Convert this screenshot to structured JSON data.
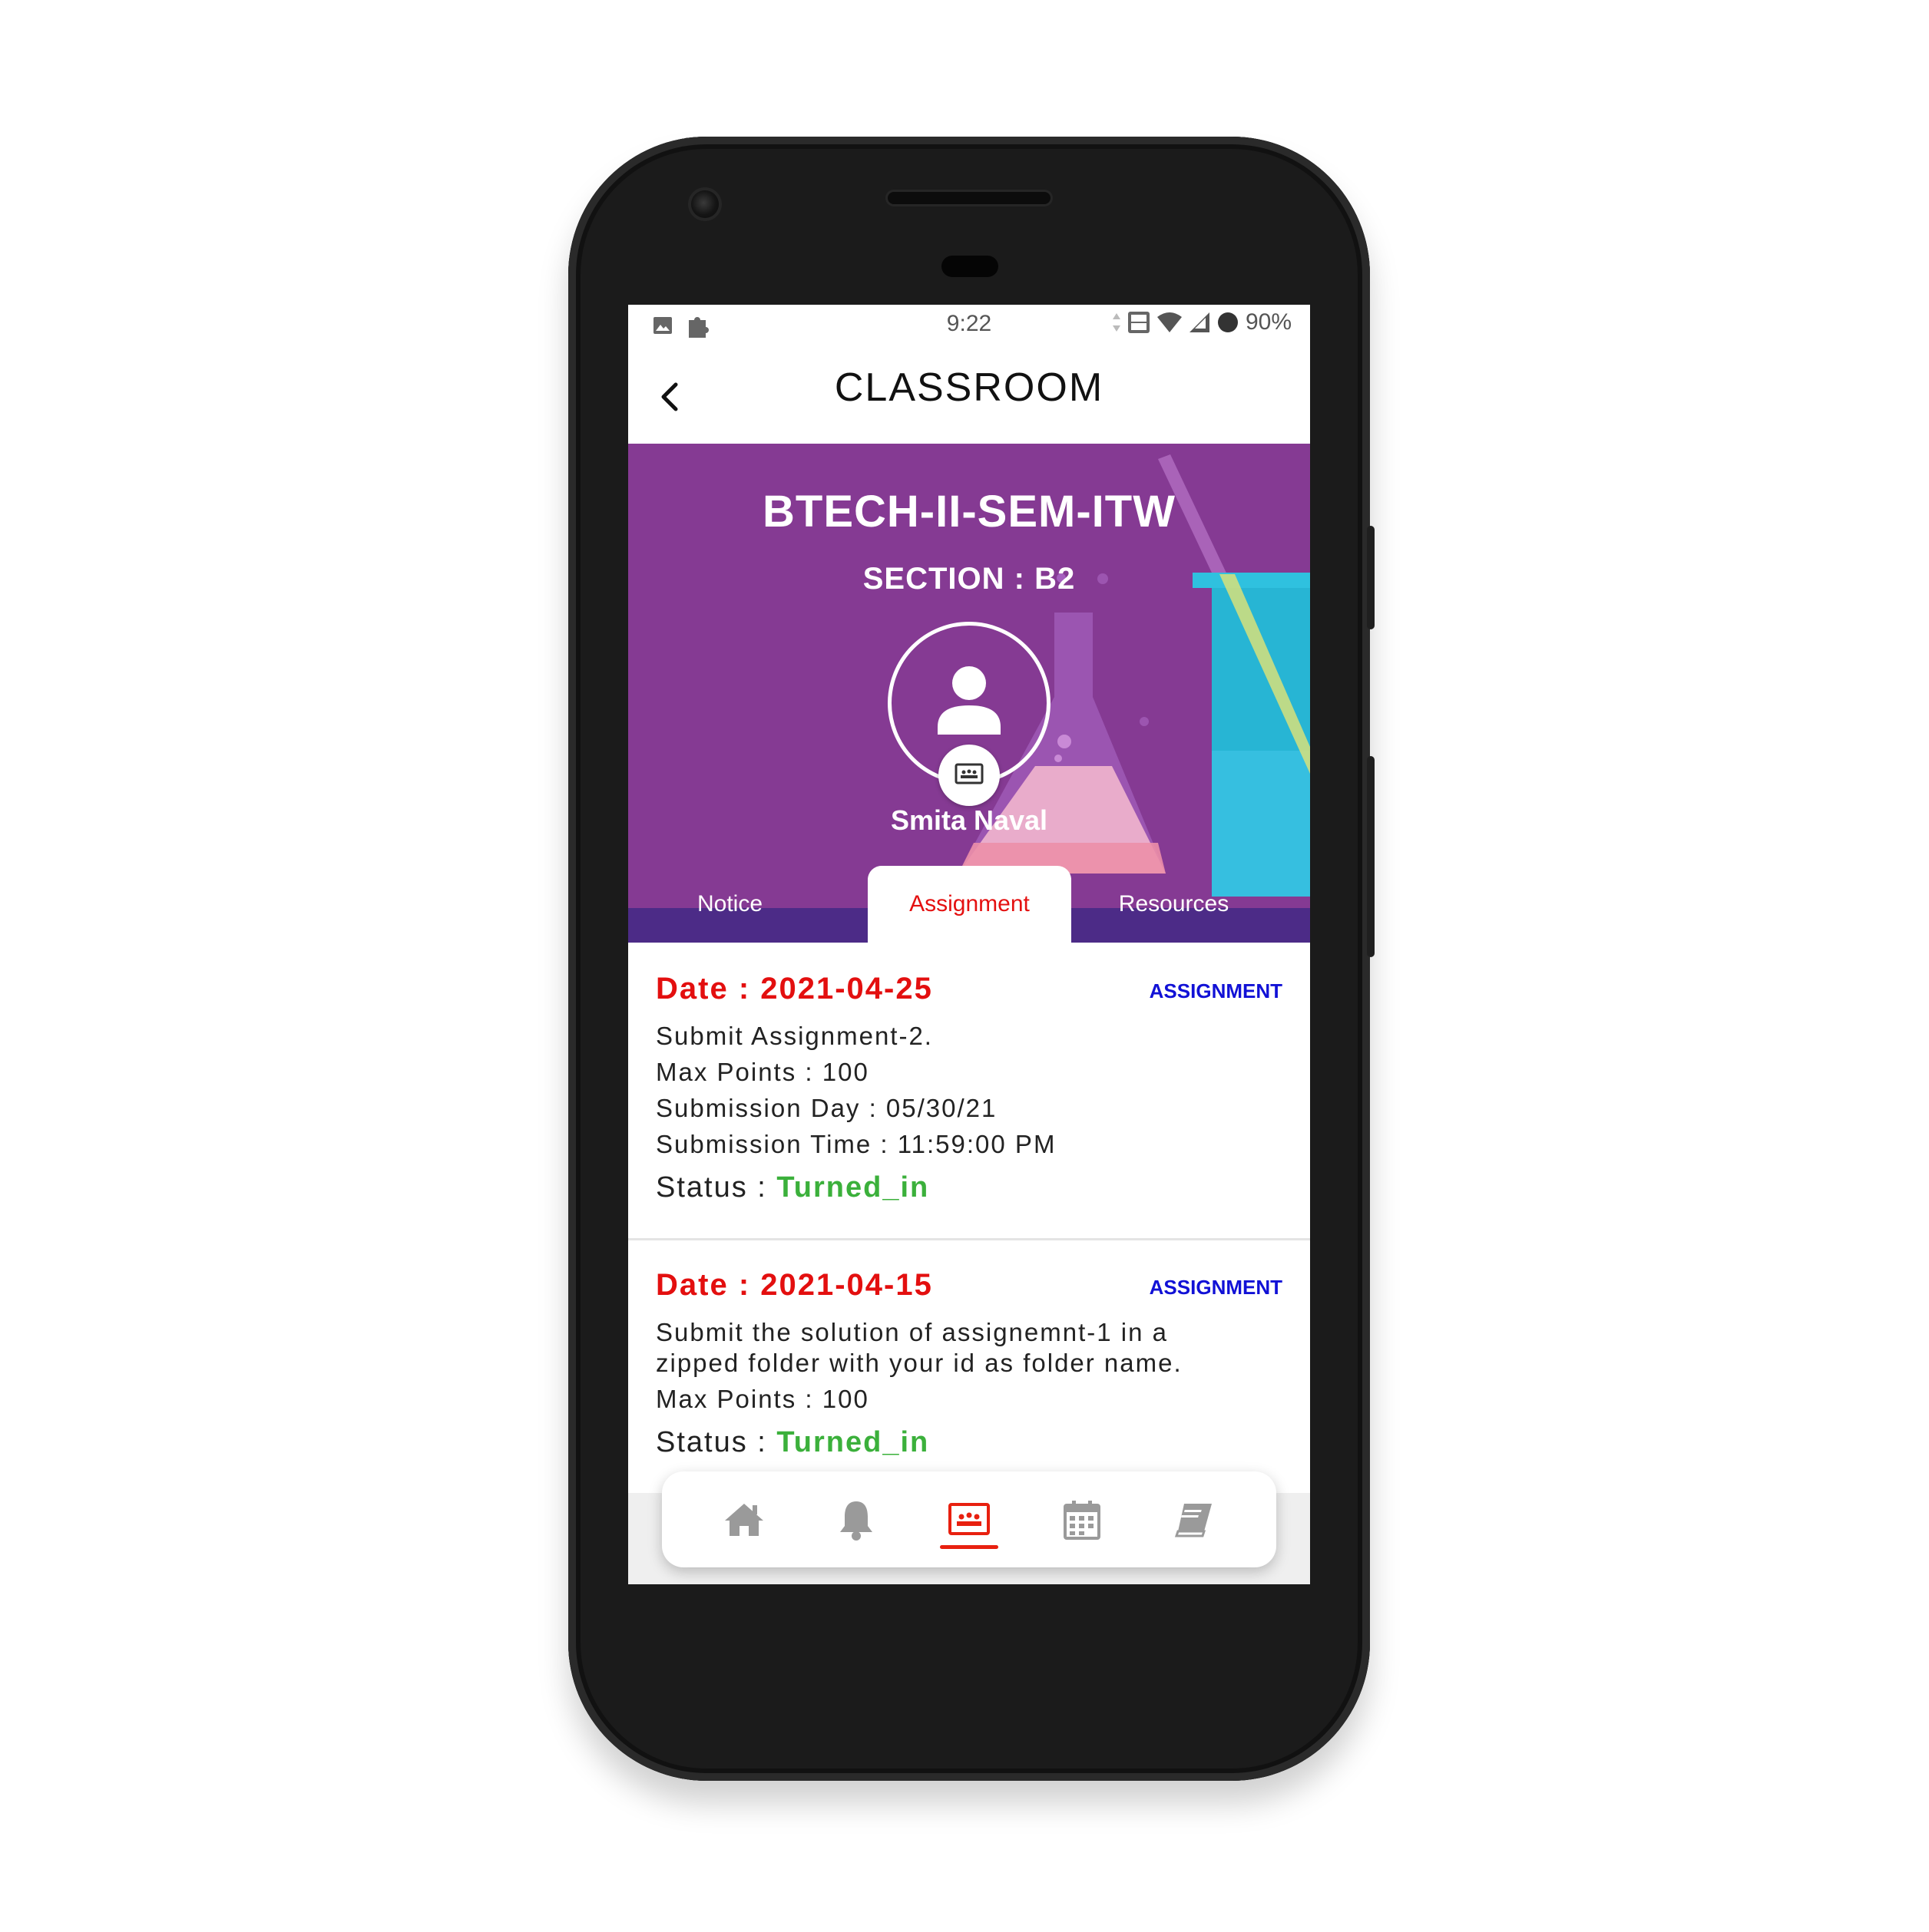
{
  "status_bar": {
    "time": "9:22",
    "battery": "90%"
  },
  "app_bar": {
    "title": "CLASSROOM",
    "back_icon": "chevron-left-icon"
  },
  "banner": {
    "class_name": "BTECH-II-SEM-ITW",
    "section": "SECTION : B2",
    "teacher_name": "Smita Naval",
    "background_color": "#853a93"
  },
  "tabs": [
    {
      "label": "Notice",
      "active": false
    },
    {
      "label": "Assignment",
      "active": true
    },
    {
      "label": "Resources",
      "active": false
    }
  ],
  "assignments": [
    {
      "date": "Date : 2021-04-25",
      "type": "ASSIGNMENT",
      "lines": [
        "Submit Assignment-2.",
        "Max Points : 100",
        "Submission Day : 05/30/21",
        "Submission Time : 11:59:00 PM"
      ],
      "status_label": "Status : ",
      "status_value": "Turned_in"
    },
    {
      "date": "Date : 2021-04-15",
      "type": "ASSIGNMENT",
      "lines": [
        "Submit the solution of assignemnt-1 in a",
        "zipped folder with your id as folder name.",
        "Max Points : 100"
      ],
      "status_label": "Status : ",
      "status_value": "Turned_in"
    }
  ],
  "bottom_nav": [
    {
      "icon": "home-icon",
      "active": false
    },
    {
      "icon": "bell-icon",
      "active": false
    },
    {
      "icon": "classroom-icon",
      "active": true
    },
    {
      "icon": "calendar-icon",
      "active": false
    },
    {
      "icon": "book-icon",
      "active": false
    }
  ],
  "colors": {
    "accent_red": "#e30f0f",
    "status_green": "#3bb03b",
    "type_blue": "#1111d6",
    "tab_bar": "#4c2b87"
  }
}
